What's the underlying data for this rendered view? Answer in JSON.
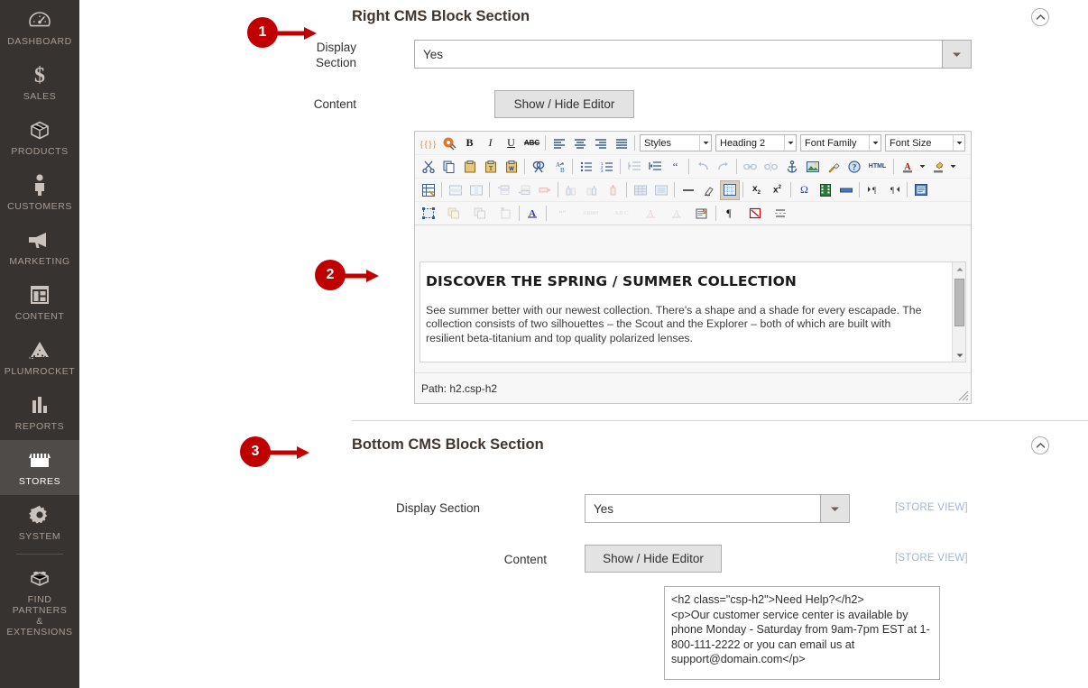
{
  "sidebar": {
    "items": [
      {
        "label": "DASHBOARD",
        "icon": "dashboard-gauge-icon",
        "active": false
      },
      {
        "label": "SALES",
        "icon": "dollar-sign-icon",
        "active": false
      },
      {
        "label": "PRODUCTS",
        "icon": "box-icon",
        "active": false
      },
      {
        "label": "CUSTOMERS",
        "icon": "person-icon",
        "active": false
      },
      {
        "label": "MARKETING",
        "icon": "megaphone-icon",
        "active": false
      },
      {
        "label": "CONTENT",
        "icon": "layout-window-icon",
        "active": false
      },
      {
        "label": "PLUMROCKET",
        "icon": "plumrocket-triangle-icon",
        "active": false
      },
      {
        "label": "REPORTS",
        "icon": "bar-chart-icon",
        "active": false
      },
      {
        "label": "STORES",
        "icon": "storefront-icon",
        "active": true
      },
      {
        "label": "SYSTEM",
        "icon": "gear-icon",
        "active": false
      },
      {
        "label": "FIND PARTNERS\n& EXTENSIONS",
        "icon": "lego-brick-icon",
        "active": false
      }
    ]
  },
  "right_section": {
    "title": "Right CMS Block Section",
    "collapse_icon": "chevron-up-circle-icon",
    "display_label": "Display\nSection",
    "display_value": "Yes",
    "content_label": "Content",
    "content_button": "Show / Hide Editor"
  },
  "editor": {
    "toolbar_row1": {
      "buttons": [
        {
          "name": "magento-variable-icon",
          "glyph": "{{}}",
          "state": "normal"
        },
        {
          "name": "magento-widget-icon",
          "glyph": "W",
          "state": "normal"
        },
        {
          "name": "bold-icon",
          "glyph": "B",
          "state": "normal"
        },
        {
          "name": "italic-icon",
          "glyph": "I",
          "state": "normal"
        },
        {
          "name": "underline-icon",
          "glyph": "U",
          "state": "normal"
        },
        {
          "name": "strikethrough-icon",
          "glyph": "ABC",
          "state": "normal"
        },
        {
          "name": "align-left-icon",
          "glyph": "",
          "state": "normal"
        },
        {
          "name": "align-center-icon",
          "glyph": "",
          "state": "normal"
        },
        {
          "name": "align-right-icon",
          "glyph": "",
          "state": "normal"
        },
        {
          "name": "align-justify-icon",
          "glyph": "",
          "state": "normal"
        }
      ],
      "selects": [
        {
          "name": "styles-select",
          "label": "Styles",
          "width": 78
        },
        {
          "name": "format-select",
          "label": "Heading 2",
          "width": 88
        },
        {
          "name": "font-family-select",
          "label": "Font Family",
          "width": 88
        },
        {
          "name": "font-size-select",
          "label": "Font Size",
          "width": 88
        }
      ]
    },
    "toolbar_row2": [
      "cut-icon",
      "copy-icon",
      "paste-icon",
      "paste-as-text-icon",
      "paste-from-word-icon",
      "find-icon",
      "find-replace-icon",
      "bullet-list-icon",
      "numbered-list-icon",
      "outdent-icon",
      "indent-icon",
      "blockquote-icon",
      "undo-icon",
      "redo-icon",
      "insert-link-icon",
      "unlink-icon",
      "anchor-icon",
      "insert-image-icon",
      "cleanup-icon",
      "help-icon",
      "html-source-icon",
      "text-color-icon",
      "text-color-arrow-icon",
      "background-color-icon",
      "background-color-arrow-icon"
    ],
    "toolbar_row3": [
      "insert-table-icon",
      "table-row-props-icon",
      "table-cell-props-icon",
      "insert-row-before-icon",
      "insert-row-after-icon",
      "delete-row-icon",
      "insert-col-before-icon",
      "insert-col-after-icon",
      "delete-col-icon",
      "split-cells-icon",
      "merge-cells-icon",
      "horizontal-rule-icon",
      "remove-format-icon",
      "toggle-guides-icon",
      "subscript-icon",
      "superscript-icon",
      "special-char-icon",
      "insert-media-icon",
      "insert-nonbreaking-icon",
      "ltr-icon",
      "rtl-icon",
      "visual-aid-icon"
    ],
    "toolbar_row4": [
      "select-all-icon",
      "restore-draft-icon",
      "copy-style-icon",
      "insert-layer-icon",
      "spellcheck-icon",
      "quote-icon",
      "abbr-icon",
      "acronym-icon",
      "del-icon",
      "ins-icon",
      "attributes-icon",
      "show-paragraphs-icon",
      "no-break-icon",
      "page-break-icon"
    ],
    "content_heading": "DISCOVER THE SPRING / SUMMER COLLECTION",
    "content_paragraph": "See summer better with our newest collection. There's a shape and a shade for every escapade. The collection consists of two silhouettes – the Scout and the Explorer – both of which are built with resilient beta-titanium and top quality polarized lenses.",
    "path_label": "Path: h2.csp-h2",
    "scrollbar_up_icon": "scroll-up-arrow-icon",
    "scrollbar_down_icon": "scroll-down-arrow-icon",
    "resize_grip_icon": "resize-grip-icon"
  },
  "bottom_section": {
    "title": "Bottom CMS Block Section",
    "collapse_icon": "chevron-up-circle-icon",
    "display_label": "Display Section",
    "display_value": "Yes",
    "display_scope": "[STORE VIEW]",
    "content_label": "Content",
    "content_button": "Show / Hide Editor",
    "content_scope": "[STORE VIEW]",
    "html_value": "<h2 class=\"csp-h2\">Need Help?</h2>\n<p>Our customer service center is available by phone Monday - Saturday from 9am-7pm EST at 1-800-111-2222 or you can email us at support@domain.com</p>"
  },
  "annotations": [
    {
      "number": "1",
      "color": "#c00000"
    },
    {
      "number": "2",
      "color": "#c00000"
    },
    {
      "number": "3",
      "color": "#c00000"
    }
  ],
  "colors": {
    "sidebar_bg": "#373330",
    "sidebar_active": "#4f4b48",
    "annotation_red": "#c00000",
    "scope_note": "#a3b5ce",
    "heading": "#41362f"
  }
}
